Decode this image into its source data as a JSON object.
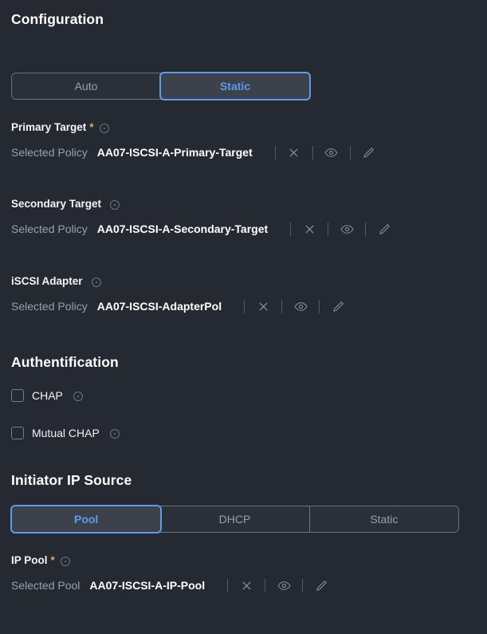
{
  "theme": {
    "background": "#252932",
    "accent_blue": "#5b9ceb",
    "required_star": "#e0a96d",
    "muted_text": "#9aa0ad",
    "value_text": "#ffffff"
  },
  "headings": {
    "configuration": "Configuration",
    "authentification": "Authentification",
    "initiator_ip_source": "Initiator IP Source"
  },
  "configuration_toggle": {
    "name": "configuration-mode",
    "options": [
      {
        "label": "Auto",
        "selected": false
      },
      {
        "label": "Static",
        "selected": true
      }
    ]
  },
  "fields": [
    {
      "key": "primary_target",
      "label": "Primary Target",
      "required": true,
      "required_marker": "*",
      "info": "info-icon",
      "selection_label": "Selected Policy",
      "selection_value": "AA07-ISCSI-A-Primary-Target",
      "actions": [
        "close-icon",
        "eye-icon",
        "pencil-icon"
      ]
    },
    {
      "key": "secondary_target",
      "label": "Secondary Target",
      "required": false,
      "required_marker": "",
      "info": "info-icon",
      "selection_label": "Selected Policy",
      "selection_value": "AA07-ISCSI-A-Secondary-Target",
      "actions": [
        "close-icon",
        "eye-icon",
        "pencil-icon"
      ]
    },
    {
      "key": "iscsi_adapter",
      "label": "iSCSI Adapter",
      "required": false,
      "required_marker": "",
      "info": "info-icon",
      "selection_label": "Selected Policy",
      "selection_value": "AA07-ISCSI-AdapterPol",
      "actions": [
        "close-icon",
        "eye-icon",
        "pencil-icon"
      ]
    },
    {
      "key": "ip_pool",
      "label": "IP Pool",
      "required": true,
      "required_marker": "*",
      "info": "info-icon",
      "selection_label": "Selected Pool",
      "selection_value": "AA07-ISCSI-A-IP-Pool",
      "actions": [
        "close-icon",
        "eye-icon",
        "pencil-icon"
      ]
    }
  ],
  "authentification": {
    "checkboxes": [
      {
        "label": "CHAP",
        "checked": false,
        "info": "info-icon"
      },
      {
        "label": "Mutual CHAP",
        "checked": false,
        "info": "info-icon"
      }
    ]
  },
  "initiator_ip_source_toggle": {
    "name": "initiator-ip-source",
    "options": [
      {
        "label": "Pool",
        "selected": true
      },
      {
        "label": "DHCP",
        "selected": false
      },
      {
        "label": "Static",
        "selected": false
      }
    ]
  }
}
